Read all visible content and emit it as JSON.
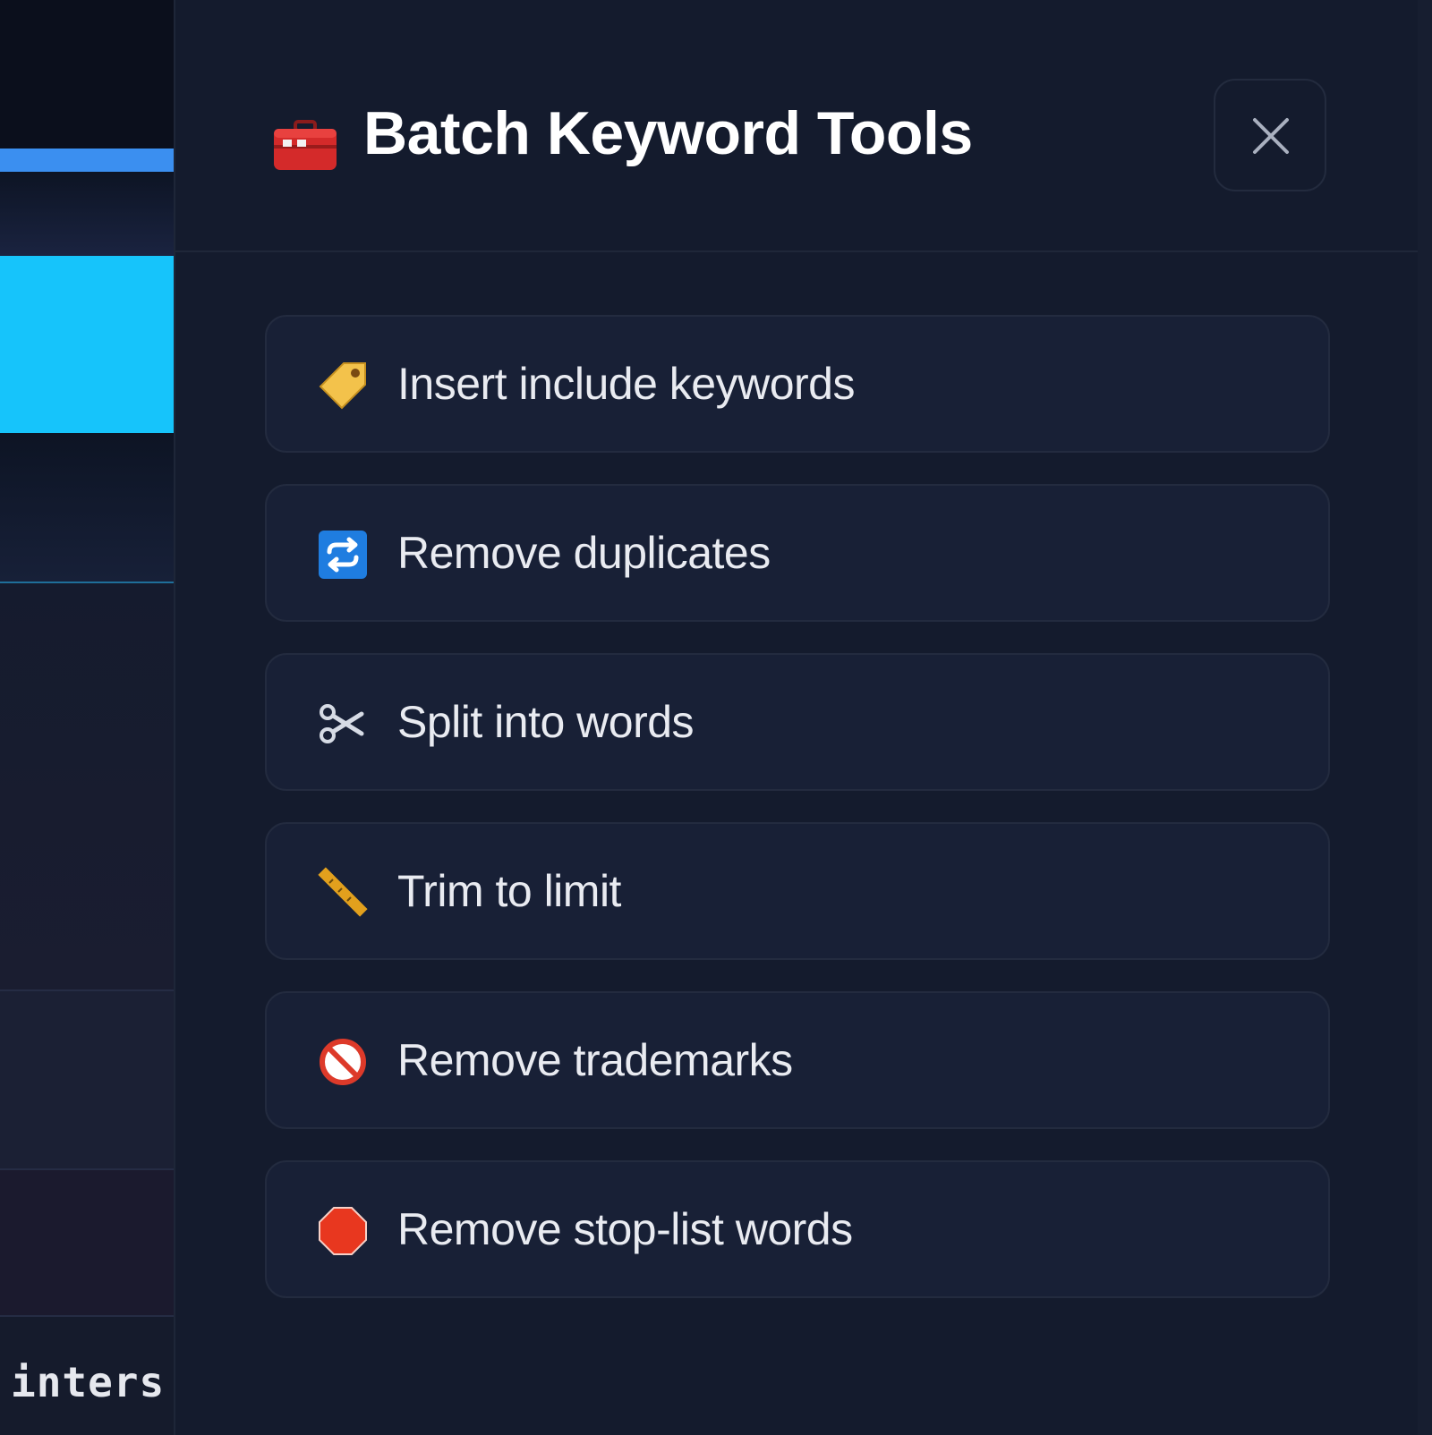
{
  "background": {
    "code_snippet": "inters"
  },
  "panel": {
    "title": "Batch Keyword Tools",
    "title_icon": "toolbox-icon",
    "close_icon": "close-icon"
  },
  "actions": [
    {
      "label": "Insert include keywords",
      "icon": "label-tag-icon"
    },
    {
      "label": "Remove duplicates",
      "icon": "repeat-icon"
    },
    {
      "label": "Split into words",
      "icon": "scissors-icon"
    },
    {
      "label": "Trim to limit",
      "icon": "ruler-icon"
    },
    {
      "label": "Remove trademarks",
      "icon": "prohibited-icon"
    },
    {
      "label": "Remove stop-list words",
      "icon": "stop-sign-icon"
    }
  ],
  "colors": {
    "panel_bg": "#141b2d",
    "item_bg": "#182036",
    "item_border": "#232b3f",
    "text": "#e9ebf1",
    "accent_cyan": "#16c4fb",
    "accent_blue": "#3b8ff0"
  }
}
